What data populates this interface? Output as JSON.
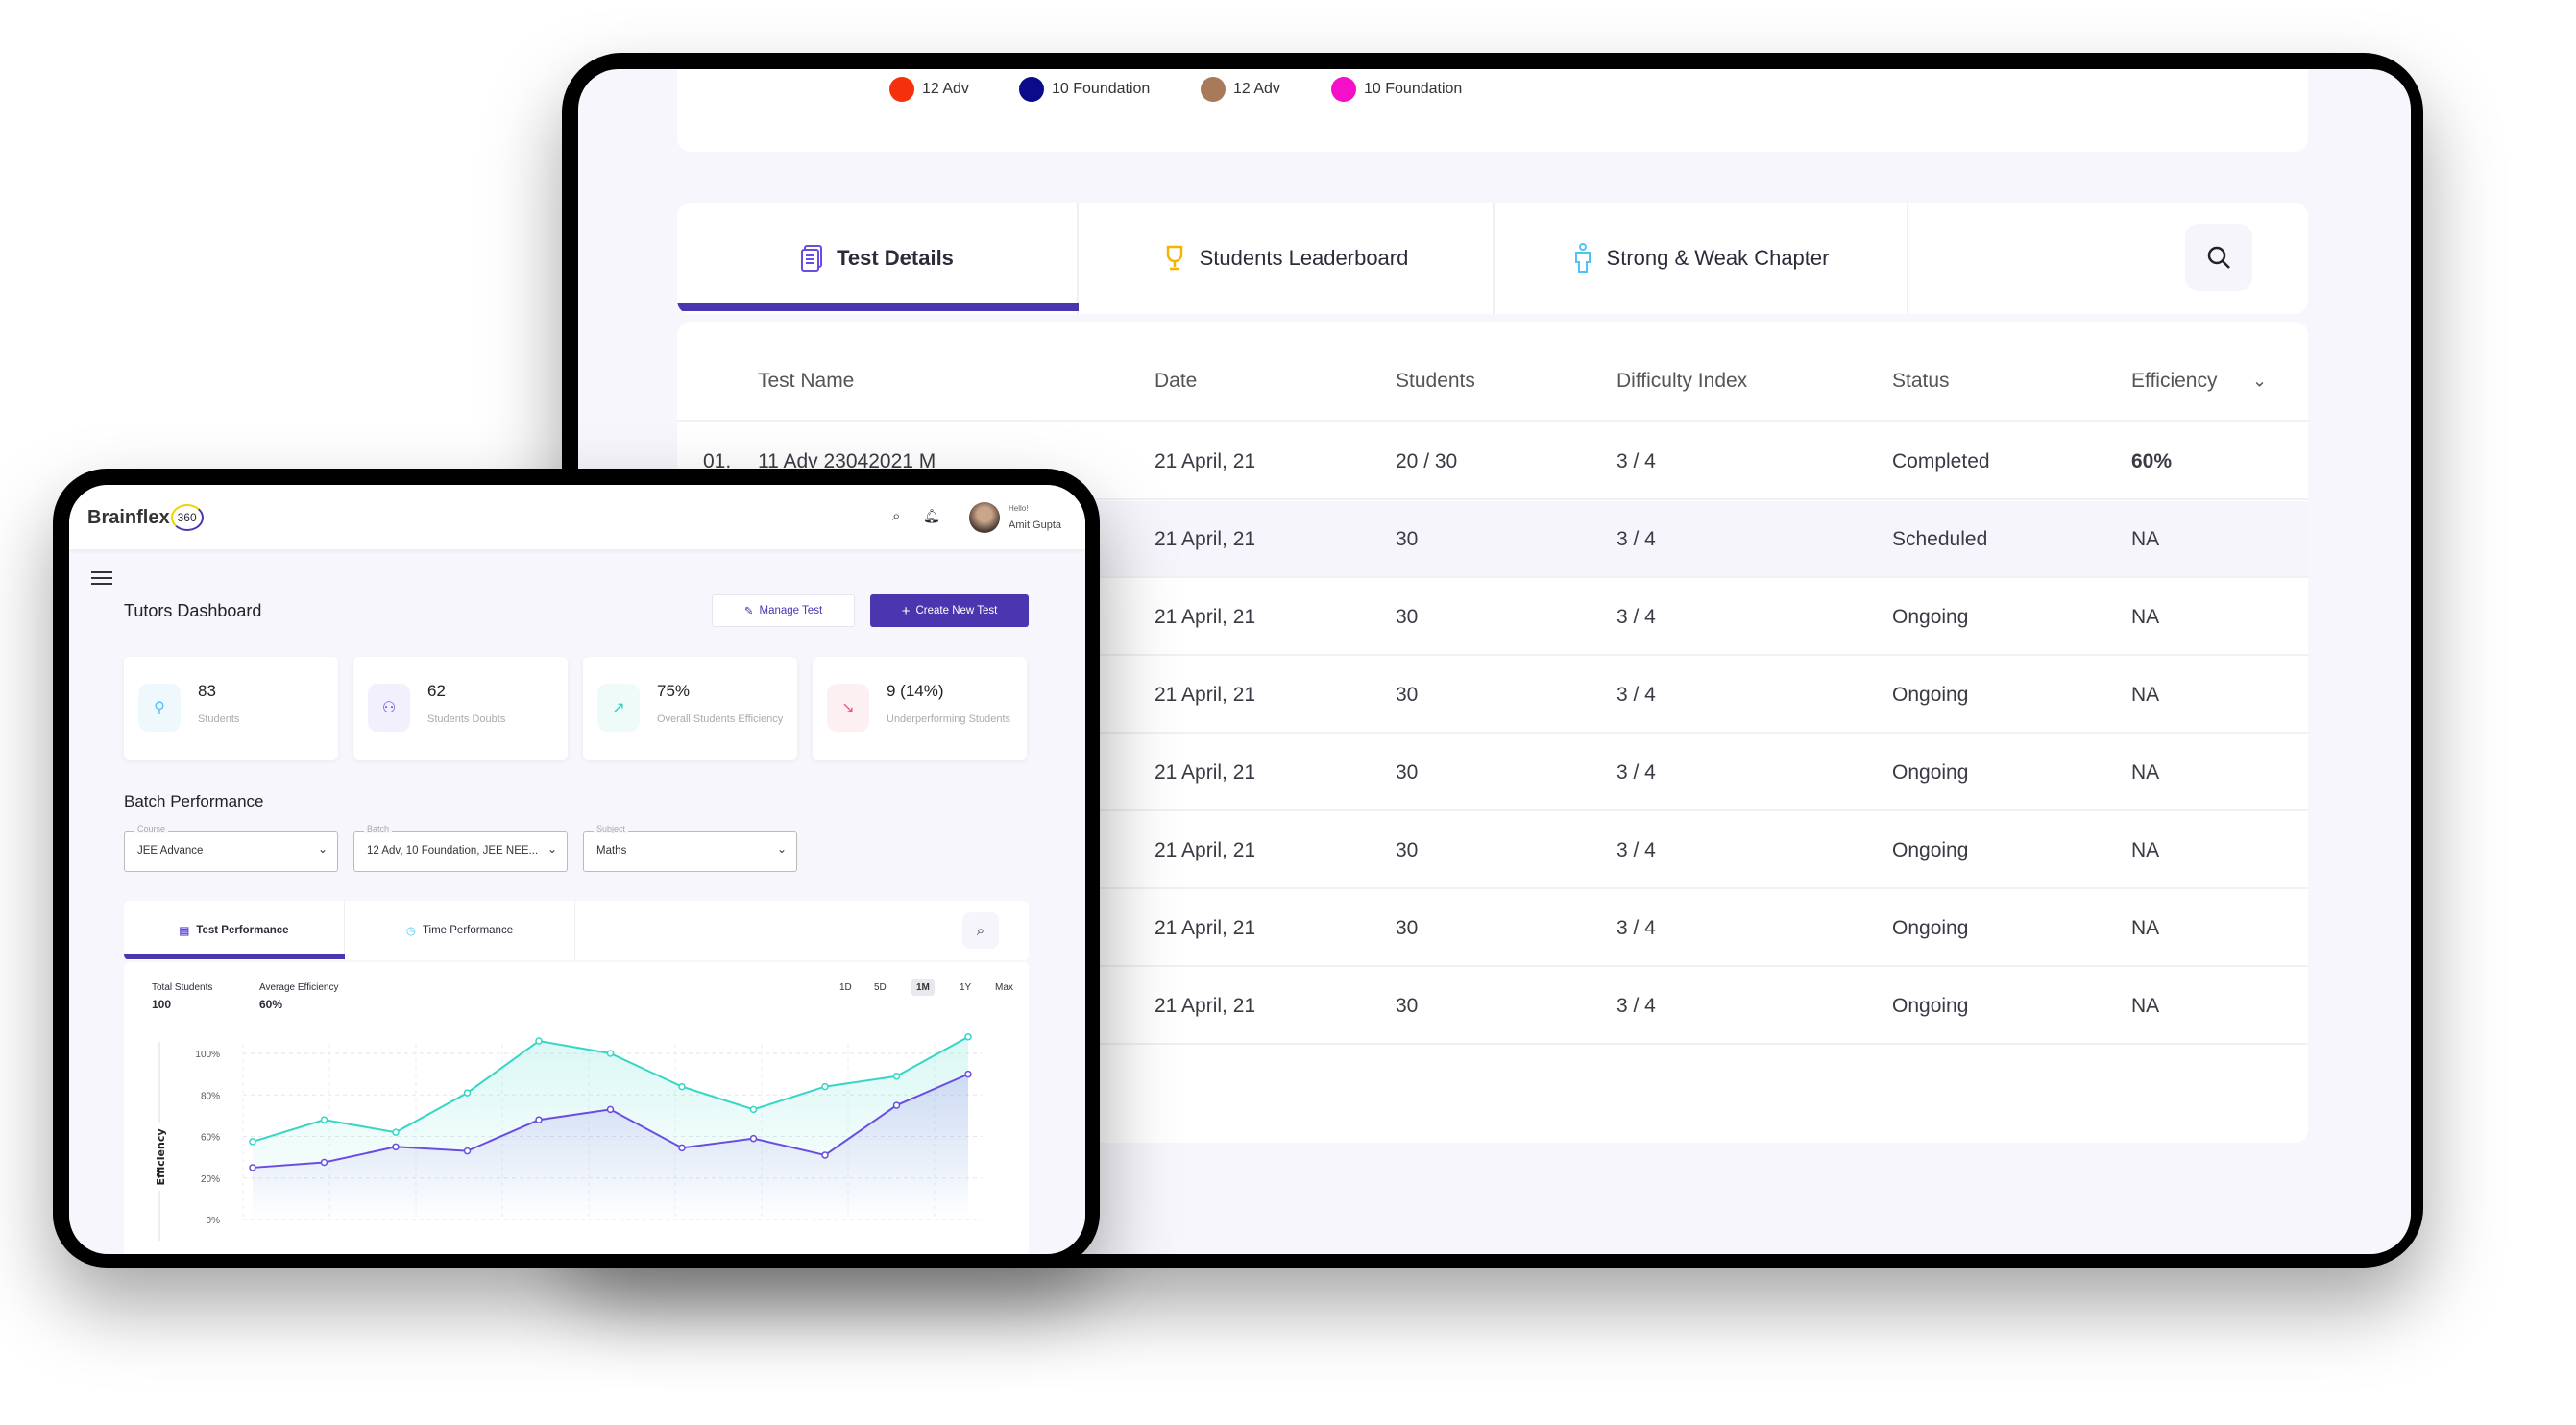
{
  "back_tablet": {
    "legend": [
      {
        "label": "12 Adv",
        "color": "#f5300b"
      },
      {
        "label": "10 Foundation",
        "color": "#0a0a8a"
      },
      {
        "label": "12 Adv",
        "color": "#a87a5a"
      },
      {
        "label": "10 Foundation",
        "color": "#f50fc8"
      }
    ],
    "tabs": [
      {
        "label": "Test Details",
        "icon": "document-icon",
        "active": true
      },
      {
        "label": "Students Leaderboard",
        "icon": "trophy-icon"
      },
      {
        "label": "Strong & Weak Chapter",
        "icon": "person-icon"
      }
    ],
    "search_icon": "search-icon",
    "table": {
      "headers": [
        "Test Name",
        "Date",
        "Students",
        "Difficulty Index",
        "Status",
        "Efficiency"
      ],
      "rows": [
        {
          "no": "01.",
          "name": "11 Adv 23042021 M",
          "date": "21 April, 21",
          "students": "20 / 30",
          "difficulty": "3 / 4",
          "status": "Completed",
          "efficiency": "60%"
        },
        {
          "date": "21 April, 21",
          "students": "30",
          "difficulty": "3 / 4",
          "status": "Scheduled",
          "efficiency": "NA"
        },
        {
          "date": "21 April, 21",
          "students": "30",
          "difficulty": "3 / 4",
          "status": "Ongoing",
          "efficiency": "NA"
        },
        {
          "date": "21 April, 21",
          "students": "30",
          "difficulty": "3 / 4",
          "status": "Ongoing",
          "efficiency": "NA"
        },
        {
          "date": "21 April, 21",
          "students": "30",
          "difficulty": "3 / 4",
          "status": "Ongoing",
          "efficiency": "NA"
        },
        {
          "date": "21 April, 21",
          "students": "30",
          "difficulty": "3 / 4",
          "status": "Ongoing",
          "efficiency": "NA"
        },
        {
          "date": "21 April, 21",
          "students": "30",
          "difficulty": "3 / 4",
          "status": "Ongoing",
          "efficiency": "NA"
        },
        {
          "date": "21 April, 21",
          "students": "30",
          "difficulty": "3 / 4",
          "status": "Ongoing",
          "efficiency": "NA"
        }
      ]
    }
  },
  "front_tablet": {
    "logo": {
      "text": "Brainflex",
      "badge": "360"
    },
    "user": {
      "greeting": "Hello!",
      "name": "Amit Gupta"
    },
    "title": "Tutors Dashboard",
    "buttons": {
      "manage": "Manage Test",
      "create": "Create New Test"
    },
    "accent": "#4b36b0",
    "stats": [
      {
        "value": "83",
        "label": "Students",
        "icon": "person-icon",
        "color": "#4fc3f7",
        "bg": "#eef8fd"
      },
      {
        "value": "62",
        "label": "Students Doubts",
        "icon": "question-person-icon",
        "color": "#6a4de0",
        "bg": "#f3f0fd"
      },
      {
        "value": "75%",
        "label": "Overall Students Efficiency",
        "icon": "trend-up-icon",
        "color": "#2ed3b7",
        "bg": "#eefbf8"
      },
      {
        "value": "9 (14%)",
        "label": "Underperforming Students",
        "icon": "trend-down-icon",
        "color": "#f0506e",
        "bg": "#fdf0f2"
      }
    ],
    "batch_title": "Batch Performance",
    "filters": [
      {
        "caption": "Course",
        "value": "JEE Advance"
      },
      {
        "caption": "Batch",
        "value": "12 Adv, 10 Foundation, JEE NEE..."
      },
      {
        "caption": "Subject",
        "value": "Maths"
      }
    ],
    "chart_tabs": [
      {
        "label": "Test Performance",
        "active": true
      },
      {
        "label": "Time Performance"
      }
    ],
    "summary": [
      {
        "label": "Total Students",
        "value": "100"
      },
      {
        "label": "Average Efficiency",
        "value": "60%"
      }
    ],
    "ranges": [
      "1D",
      "5D",
      "1M",
      "1Y",
      "Max"
    ],
    "selected_range": "1M"
  },
  "chart_data": {
    "type": "area",
    "ylabel": "Efficiency",
    "y_ticks": [
      "100%",
      "80%",
      "60%",
      "20%",
      "0%"
    ],
    "y_tick_values": [
      100,
      80,
      60,
      20,
      0
    ],
    "grid": true,
    "series": [
      {
        "color": "#35d6c4",
        "values": [
          55,
          68,
          62,
          81,
          106,
          100,
          84,
          73,
          84,
          89,
          108
        ]
      },
      {
        "color": "#6a4de0",
        "values": [
          30,
          35,
          50,
          46,
          68,
          73,
          49,
          58,
          42,
          75,
          90
        ]
      }
    ]
  }
}
